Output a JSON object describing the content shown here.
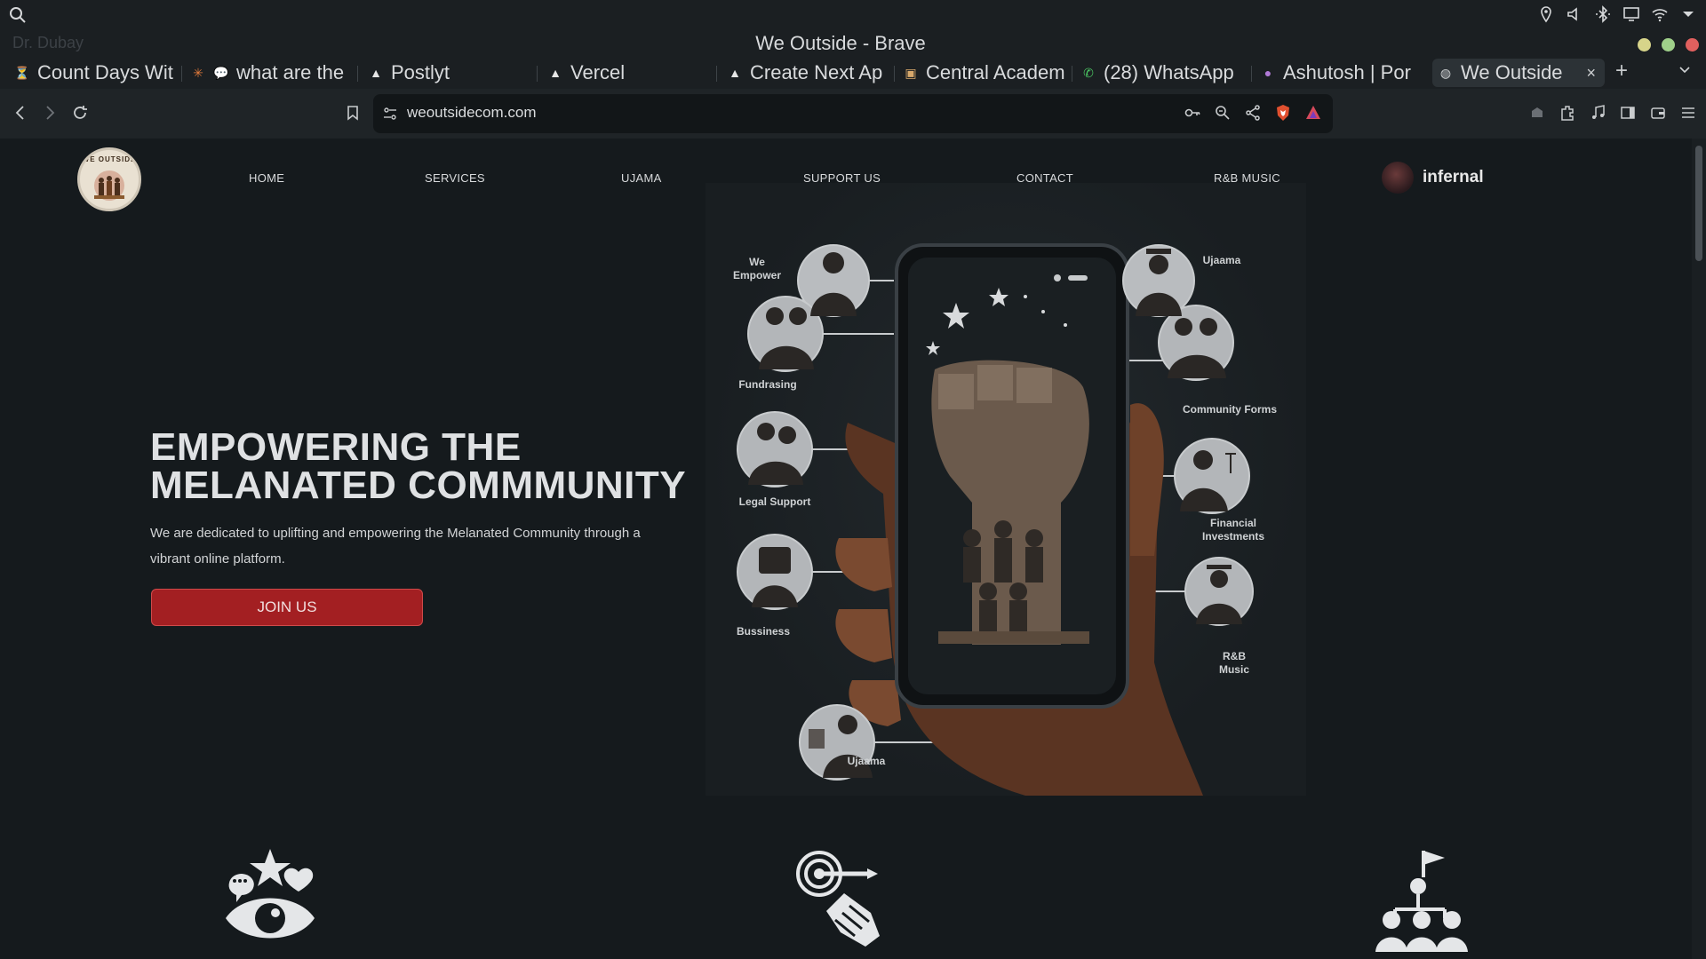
{
  "window": {
    "title": "We Outside - Brave",
    "ghost_tab_label": "Dr. Dubay"
  },
  "tabs": [
    {
      "label": "Count Days Wit",
      "icon": "timer-favicon"
    },
    {
      "label": "what are the",
      "icon": "chat-favicon"
    },
    {
      "label": "Postlyt",
      "icon": "vercel-favicon"
    },
    {
      "label": "Vercel",
      "icon": "vercel-favicon"
    },
    {
      "label": "Create Next Ap",
      "icon": "vercel-favicon"
    },
    {
      "label": "Central Academ",
      "icon": "academy-favicon"
    },
    {
      "label": "(28) WhatsApp",
      "icon": "whatsapp-favicon"
    },
    {
      "label": "Ashutosh | Por",
      "icon": "portfolio-favicon"
    },
    {
      "label": "We Outside",
      "icon": "globe-favicon",
      "active": true
    }
  ],
  "new_tab_label": "+",
  "close_tab_label": "×",
  "address_bar": {
    "url": "weoutsidecom.com"
  },
  "site": {
    "logo_text": "WE OUTSIDE",
    "nav": [
      {
        "label": "HOME"
      },
      {
        "label": "SERVICES"
      },
      {
        "label": "UJAMA"
      },
      {
        "label": "SUPPORT US"
      },
      {
        "label": "CONTACT"
      },
      {
        "label": "R&B MUSIC"
      }
    ],
    "user_name": "infernal",
    "hero": {
      "title_line1": "EMPOWERING THE",
      "title_line2": "MELANATED COMMMUNITY",
      "description": "We are dedicated to uplifting and empowering the Melanated Community through a vibrant online platform.",
      "cta": "JOIN US"
    },
    "art_labels": {
      "we_empower_1": "We",
      "we_empower_2": "Empower",
      "fundrasing": "Fundrasing",
      "legal_support": "Legal Support",
      "bussiness": "Bussiness",
      "ujaama_bottom": "Ujaama",
      "ujaama_top": "Ujaama",
      "community_forms": "Community Forms",
      "financial_1": "Financial",
      "financial_2": "Investments",
      "rnb_1": "R&B",
      "rnb_2": "Music"
    },
    "feature_icons": [
      "eye-stars-hearts-icon",
      "target-handshake-icon",
      "team-flag-icon"
    ]
  },
  "colors": {
    "page_bg": "#151a1d",
    "cta_red": "#a31f22",
    "text": "#dfe1e3"
  }
}
